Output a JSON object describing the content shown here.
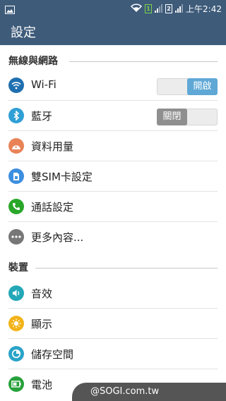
{
  "status_bar": {
    "time": "上午2:42",
    "sim1": "1",
    "sim2": "2"
  },
  "app_bar": {
    "title": "設定"
  },
  "sections": {
    "network": {
      "label": "無線與網路"
    },
    "device": {
      "label": "裝置"
    }
  },
  "items": {
    "wifi": {
      "label": "Wi-Fi",
      "toggle_label": "開啟",
      "toggle_state": "on",
      "icon": "wifi-icon",
      "color": "#1e6fb0"
    },
    "bluetooth": {
      "label": "藍牙",
      "toggle_label": "關閉",
      "toggle_state": "off",
      "icon": "bluetooth-icon",
      "color": "#2f9fd6"
    },
    "data_usage": {
      "label": "資料用量",
      "icon": "data-usage-icon",
      "color": "#e98357"
    },
    "dual_sim": {
      "label": "雙SIM卡設定",
      "icon": "sim-card-icon",
      "color": "#3c8ee0"
    },
    "call_settings": {
      "label": "通話設定",
      "icon": "phone-icon",
      "color": "#2aa72a"
    },
    "more": {
      "label": "更多內容...",
      "icon": "more-icon",
      "color": "#777777"
    },
    "sound": {
      "label": "音效",
      "icon": "sound-icon",
      "color": "#24a8b8"
    },
    "display": {
      "label": "顯示",
      "icon": "display-icon",
      "color": "#f2b318"
    },
    "storage": {
      "label": "儲存空間",
      "icon": "storage-icon",
      "color": "#2aa3c8"
    },
    "battery": {
      "label": "電池",
      "icon": "battery-icon",
      "color": "#27a13c"
    }
  },
  "watermark": {
    "text": "@SOGI.com.tw"
  }
}
